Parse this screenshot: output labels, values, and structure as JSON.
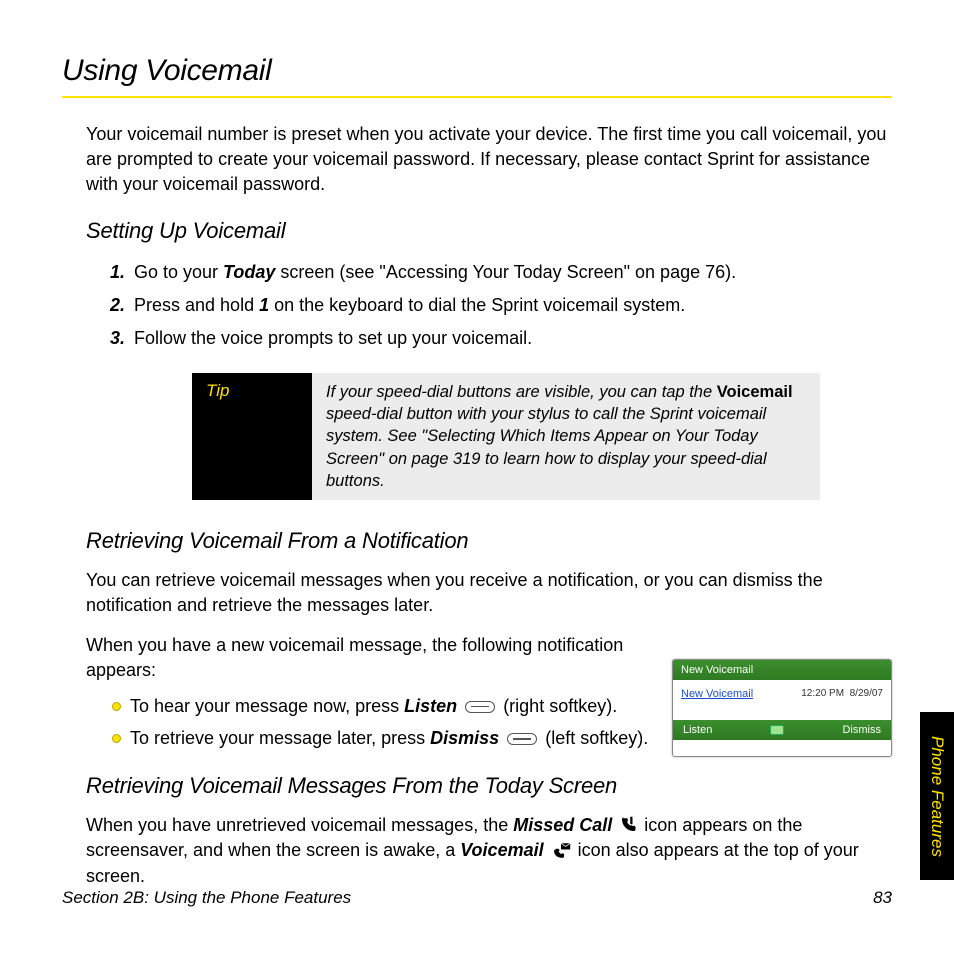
{
  "side_tab": "Phone Features",
  "title": "Using Voicemail",
  "intro": "Your voicemail number is preset when you activate your device. The first time you call voicemail, you are prompted to create your voicemail password. If necessary, please contact Sprint for assistance with your voicemail password.",
  "section_setup": {
    "heading": "Setting Up Voicemail",
    "steps": [
      {
        "num": "1.",
        "pre": "Go to your ",
        "bold": "Today",
        "post": " screen (see \"Accessing Your Today Screen\" on page 76)."
      },
      {
        "num": "2.",
        "pre": "Press and hold ",
        "bold": "1",
        "post": " on the keyboard to dial the Sprint voicemail system."
      },
      {
        "num": "3.",
        "pre": "Follow the voice prompts to set up your voicemail.",
        "bold": "",
        "post": ""
      }
    ]
  },
  "tip": {
    "label": "Tip",
    "text_pre": "If your speed-dial buttons are visible, you can tap the ",
    "text_bold": "Voicemail",
    "text_post": " speed-dial button with your stylus to call the Sprint voicemail system. See \"Selecting Which Items Appear on Your Today Screen\" on page 319 to learn how to display your speed-dial buttons."
  },
  "section_notif": {
    "heading": "Retrieving Voicemail From a Notification",
    "p1": "You can retrieve voicemail messages when you receive a notification, or you can dismiss the notification and retrieve the messages later.",
    "p2": "When you have a new voicemail message, the following notification appears:",
    "bullets": [
      {
        "pre": "To hear your message now, press ",
        "bold": "Listen",
        "post": " (right softkey)."
      },
      {
        "pre": "To retrieve your message later, press ",
        "bold": "Dismiss",
        "post": " (left softkey)."
      }
    ]
  },
  "notification_widget": {
    "header": "New Voicemail",
    "link": "New Voicemail",
    "time": "12:20 PM",
    "date": "8/29/07",
    "left_btn": "Listen",
    "right_btn": "Dismiss"
  },
  "section_today": {
    "heading": "Retrieving Voicemail Messages From the Today Screen",
    "p_pre": "When you have unretrieved voicemail messages, the ",
    "p_bold1": "Missed Call",
    "p_mid": " icon appears on the screensaver, and when the screen is awake, a ",
    "p_bold2": "Voicemail",
    "p_post": " icon also appears at the top of your screen."
  },
  "footer": {
    "section": "Section 2B: Using the Phone Features",
    "page": "83"
  }
}
